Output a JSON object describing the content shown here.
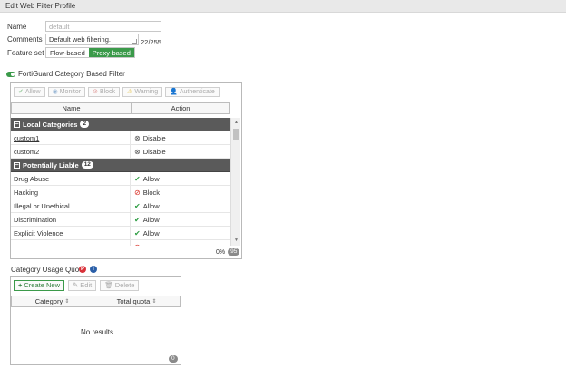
{
  "window": {
    "title": "Edit Web Filter Profile"
  },
  "form": {
    "name_label": "Name",
    "name_value": "default",
    "comments_label": "Comments",
    "comments_value": "Default web filtering.",
    "comments_counter": "22/255",
    "feature_set_label": "Feature set",
    "feature_options": [
      "Flow-based",
      "Proxy-based"
    ],
    "feature_selected": "Proxy-based"
  },
  "fortiguard": {
    "toggle_on": true,
    "label": "FortiGuard Category Based Filter",
    "toolbar": [
      {
        "label": "Allow",
        "icon": "check-circle-icon"
      },
      {
        "label": "Monitor",
        "icon": "eye-icon"
      },
      {
        "label": "Block",
        "icon": "block-icon"
      },
      {
        "label": "Warning",
        "icon": "warning-icon"
      },
      {
        "label": "Authenticate",
        "icon": "user-icon"
      }
    ],
    "columns": [
      "Name",
      "Action"
    ],
    "groups": [
      {
        "name": "Local Categories",
        "count": "2",
        "rows": [
          {
            "name": "custom1",
            "action": "Disable"
          },
          {
            "name": "custom2",
            "action": "Disable"
          }
        ]
      },
      {
        "name": "Potentially Liable",
        "count": "12",
        "rows": [
          {
            "name": "Drug Abuse",
            "action": "Allow"
          },
          {
            "name": "Hacking",
            "action": "Block"
          },
          {
            "name": "Illegal or Unethical",
            "action": "Allow"
          },
          {
            "name": "Discrimination",
            "action": "Allow"
          },
          {
            "name": "Explicit Violence",
            "action": "Allow"
          }
        ]
      }
    ],
    "footer_percent": "0%",
    "footer_count": "95"
  },
  "quota": {
    "label": "Category Usage Quota",
    "badge_red": "P",
    "badge_blue": "i",
    "buttons": {
      "create": "Create New",
      "edit": "Edit",
      "delete": "Delete"
    },
    "columns": [
      "Category",
      "Total quota"
    ],
    "empty_text": "No results",
    "footer_count": "0"
  },
  "colors": {
    "accent_green": "#3b9a4a",
    "group_header": "#5a5a5a",
    "block_red": "#d93025"
  }
}
